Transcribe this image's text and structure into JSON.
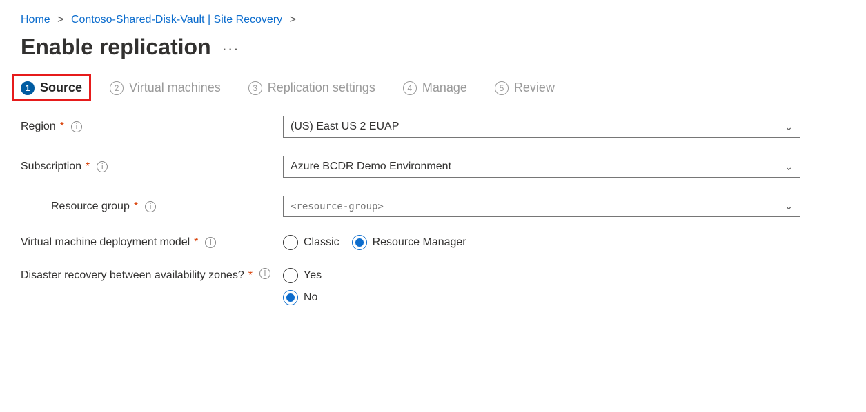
{
  "breadcrumb": {
    "home": "Home",
    "vault": "Contoso-Shared-Disk-Vault | Site Recovery"
  },
  "page": {
    "title": "Enable replication"
  },
  "steps": [
    {
      "label": "Source",
      "num": "1"
    },
    {
      "label": "Virtual machines",
      "num": "2"
    },
    {
      "label": "Replication settings",
      "num": "3"
    },
    {
      "label": "Manage",
      "num": "4"
    },
    {
      "label": "Review",
      "num": "5"
    }
  ],
  "form": {
    "region": {
      "label": "Region",
      "value": "(US) East US 2 EUAP"
    },
    "subscription": {
      "label": "Subscription",
      "value": "Azure BCDR Demo Environment"
    },
    "resourceGroup": {
      "label": "Resource group",
      "value": "<resource-group>"
    },
    "deployModel": {
      "label": "Virtual machine deployment model",
      "classic": "Classic",
      "rm": "Resource Manager"
    },
    "drZones": {
      "label": "Disaster recovery between availability zones?",
      "yes": "Yes",
      "no": "No"
    }
  }
}
